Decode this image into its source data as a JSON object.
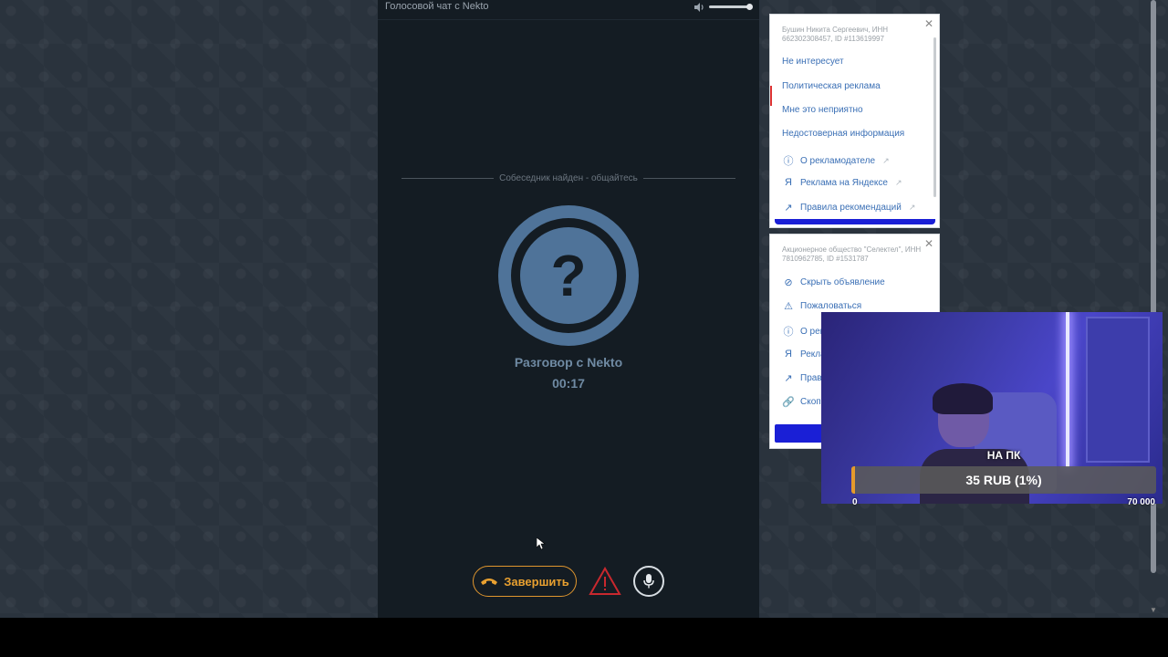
{
  "chat": {
    "title": "Голосовой чат с Nekto",
    "found_status": "Собеседник найден - общайтесь",
    "conversation_name": "Разговор с Nekto",
    "timer": "00:17",
    "end_button_label": "Завершить",
    "volume_level": 1.0
  },
  "ad1": {
    "legal": "Бушин Никита Сергеевич, ИНН 662302308457, ID #113619997",
    "items": [
      {
        "label": "Не интересует",
        "icon": ""
      },
      {
        "label": "Политическая реклама",
        "icon": ""
      },
      {
        "label": "Мне это неприятно",
        "icon": ""
      },
      {
        "label": "Недостоверная информация",
        "icon": ""
      },
      {
        "label": "О рекламодателе",
        "icon": "info-icon"
      },
      {
        "label": "Реклама на Яндексе",
        "icon": "yandex-icon"
      },
      {
        "label": "Правила рекомендаций",
        "icon": "external-arrow-icon"
      }
    ]
  },
  "ad2": {
    "legal": "Акционерное общество \"Селектел\", ИНН 7810962785, ID #1531787",
    "items": [
      {
        "label": "Скрыть объявление",
        "icon": "eye-off-icon"
      },
      {
        "label": "Пожаловаться",
        "icon": "warning-icon"
      },
      {
        "label": "О рек",
        "icon": "info-icon"
      },
      {
        "label": "Рекла",
        "icon": "yandex-icon"
      },
      {
        "label": "Прав",
        "icon": "external-arrow-icon"
      },
      {
        "label": "Скоп",
        "icon": "link-icon"
      }
    ]
  },
  "donation": {
    "label": "НА ПК",
    "amount_text": "35 RUB (1%)",
    "progress_fraction": 0.01,
    "min": "0",
    "max": "70 000"
  },
  "colors": {
    "accent_orange": "#e8a030",
    "avatar_blue": "#4f7399",
    "panel_bg": "#141c23",
    "ad_link": "#3a6fb5",
    "ad_button": "#1a1fd6"
  }
}
